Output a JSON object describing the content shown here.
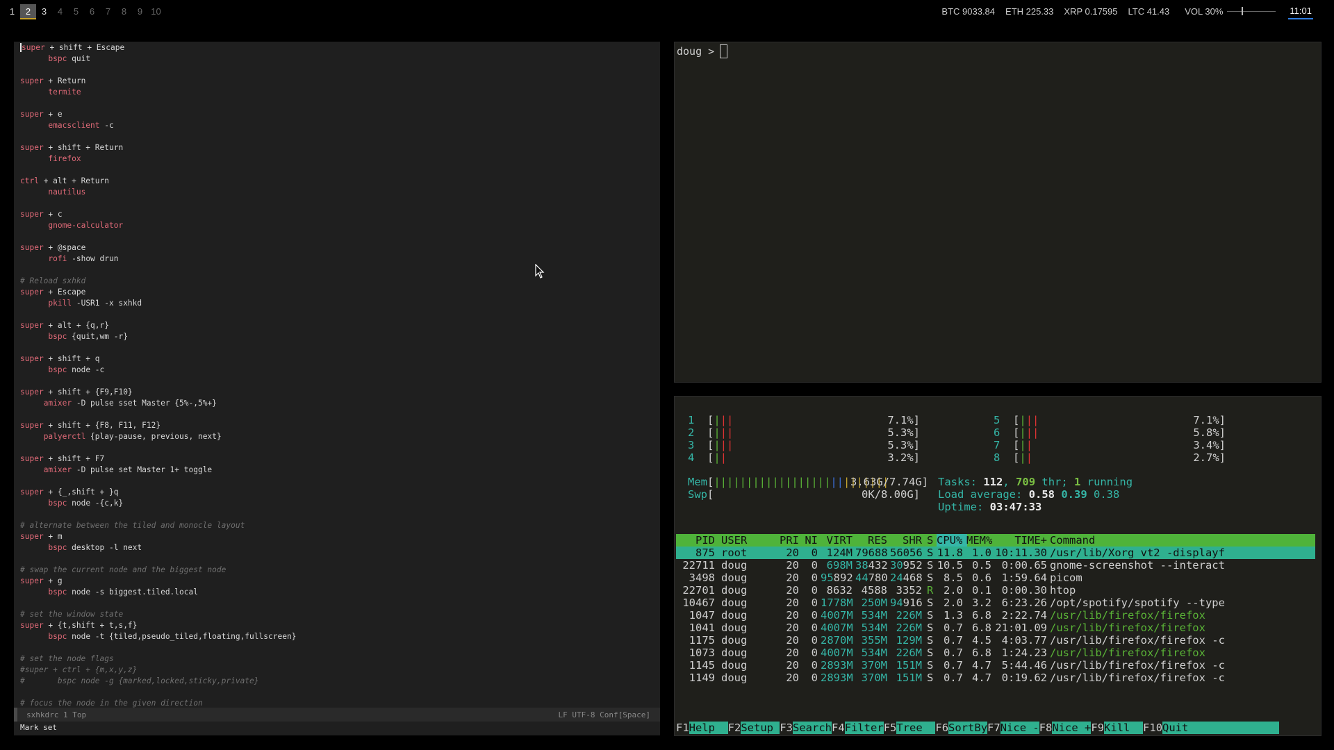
{
  "workspaces": [
    {
      "label": "1",
      "state": "occupied"
    },
    {
      "label": "2",
      "state": "active"
    },
    {
      "label": "3",
      "state": "occupied"
    },
    {
      "label": "4",
      "state": "empty"
    },
    {
      "label": "5",
      "state": "empty"
    },
    {
      "label": "6",
      "state": "empty"
    },
    {
      "label": "7",
      "state": "empty"
    },
    {
      "label": "8",
      "state": "empty"
    },
    {
      "label": "9",
      "state": "empty"
    },
    {
      "label": "10",
      "state": "empty"
    }
  ],
  "status": {
    "btc": "BTC 9033.84",
    "eth": "ETH 225.33",
    "xrp": "XRP 0.17595",
    "ltc": "LTC 41.43",
    "vol": "VOL 30%",
    "vol_level": 0.3,
    "clock": "11:01"
  },
  "editor": {
    "lines": [
      [
        [
          "kw",
          "super"
        ],
        [
          "",
          "+ shift + Escape"
        ]
      ],
      [
        [
          "",
          "      "
        ],
        [
          "kw",
          "bspc"
        ],
        [
          "",
          " quit"
        ]
      ],
      [],
      [
        [
          "kw",
          "super"
        ],
        [
          "",
          " + Return"
        ]
      ],
      [
        [
          "",
          "      "
        ],
        [
          "kw",
          "termite"
        ]
      ],
      [],
      [
        [
          "kw",
          "super"
        ],
        [
          "",
          " + e"
        ]
      ],
      [
        [
          "",
          "      "
        ],
        [
          "kw",
          "emacsclient"
        ],
        [
          "",
          " -c"
        ]
      ],
      [],
      [
        [
          "kw",
          "super"
        ],
        [
          "",
          " + shift + Return"
        ]
      ],
      [
        [
          "",
          "      "
        ],
        [
          "kw",
          "firefox"
        ]
      ],
      [],
      [
        [
          "kw",
          "ctrl"
        ],
        [
          "",
          " + alt + Return"
        ]
      ],
      [
        [
          "",
          "      "
        ],
        [
          "kw",
          "nautilus"
        ]
      ],
      [],
      [
        [
          "kw",
          "super"
        ],
        [
          "",
          " + c"
        ]
      ],
      [
        [
          "",
          "      "
        ],
        [
          "kw",
          "gnome-calculator"
        ]
      ],
      [],
      [
        [
          "kw",
          "super"
        ],
        [
          "",
          " + @space"
        ]
      ],
      [
        [
          "",
          "      "
        ],
        [
          "kw",
          "rofi"
        ],
        [
          "",
          " -show drun"
        ]
      ],
      [],
      [
        [
          "cm",
          "# Reload sxhkd"
        ]
      ],
      [
        [
          "kw",
          "super"
        ],
        [
          "",
          " + Escape"
        ]
      ],
      [
        [
          "",
          "      "
        ],
        [
          "kw",
          "pkill"
        ],
        [
          "",
          " -USR1 -x sxhkd"
        ]
      ],
      [],
      [
        [
          "kw",
          "super"
        ],
        [
          "",
          " + alt + {q,r}"
        ]
      ],
      [
        [
          "",
          "      "
        ],
        [
          "kw",
          "bspc"
        ],
        [
          "",
          " {quit,wm -r}"
        ]
      ],
      [],
      [
        [
          "kw",
          "super"
        ],
        [
          "",
          " + shift + q"
        ]
      ],
      [
        [
          "",
          "      "
        ],
        [
          "kw",
          "bspc"
        ],
        [
          "",
          " node -c"
        ]
      ],
      [],
      [
        [
          "kw",
          "super"
        ],
        [
          "",
          " + shift + {F9,F10}"
        ]
      ],
      [
        [
          "",
          "     "
        ],
        [
          "kw",
          "amixer"
        ],
        [
          "",
          " -D pulse sset Master {5%-,5%+}"
        ]
      ],
      [],
      [
        [
          "kw",
          "super"
        ],
        [
          "",
          " + shift + {F8, F11, F12}"
        ]
      ],
      [
        [
          "",
          "     "
        ],
        [
          "kw",
          "palyerctl"
        ],
        [
          "",
          " {play-pause, previous, next}"
        ]
      ],
      [],
      [
        [
          "kw",
          "super"
        ],
        [
          "",
          " + shift + F7"
        ]
      ],
      [
        [
          "",
          "     "
        ],
        [
          "kw",
          "amixer"
        ],
        [
          "",
          " -D pulse set Master 1+ toggle"
        ]
      ],
      [],
      [
        [
          "kw",
          "super"
        ],
        [
          "",
          " + {_,shift + }q"
        ]
      ],
      [
        [
          "",
          "      "
        ],
        [
          "kw",
          "bspc"
        ],
        [
          "",
          " node -{c,k}"
        ]
      ],
      [],
      [
        [
          "cm",
          "# alternate between the tiled and monocle layout"
        ]
      ],
      [
        [
          "kw",
          "super"
        ],
        [
          "",
          " + m"
        ]
      ],
      [
        [
          "",
          "      "
        ],
        [
          "kw",
          "bspc"
        ],
        [
          "",
          " desktop -l next"
        ]
      ],
      [],
      [
        [
          "cm",
          "# swap the current node and the biggest node"
        ]
      ],
      [
        [
          "kw",
          "super"
        ],
        [
          "",
          " + g"
        ]
      ],
      [
        [
          "",
          "      "
        ],
        [
          "kw",
          "bspc"
        ],
        [
          "",
          " node -s biggest.tiled.local"
        ]
      ],
      [],
      [
        [
          "cm",
          "# set the window state"
        ]
      ],
      [
        [
          "kw",
          "super"
        ],
        [
          "",
          " + {t,shift + t,s,f}"
        ]
      ],
      [
        [
          "",
          "      "
        ],
        [
          "kw",
          "bspc"
        ],
        [
          "",
          " node -t {tiled,pseudo_tiled,floating,fullscreen}"
        ]
      ],
      [],
      [
        [
          "cm",
          "# set the node flags"
        ]
      ],
      [
        [
          "cm",
          "#super + ctrl + {m,x,y,z}"
        ]
      ],
      [
        [
          "cm",
          "#       bspc node -g {marked,locked,sticky,private}"
        ]
      ],
      [],
      [
        [
          "cm",
          "# focus the node in the given direction"
        ]
      ]
    ],
    "modeline_left": "sxhkdrc   1 Top",
    "modeline_right": "LF UTF-8   Conf[Space]",
    "echo": "Mark set"
  },
  "terminal": {
    "prompt": "doug >"
  },
  "htop": {
    "cpus": [
      {
        "id": "1",
        "bars": "|||",
        "pct": "7.1%]"
      },
      {
        "id": "2",
        "bars": "|||",
        "pct": "5.3%]"
      },
      {
        "id": "3",
        "bars": "|||",
        "pct": "5.3%]"
      },
      {
        "id": "4",
        "bars": "||",
        "pct": "3.2%]"
      },
      {
        "id": "5",
        "bars": "|||",
        "pct": "7.1%]"
      },
      {
        "id": "6",
        "bars": "|||",
        "pct": "5.8%]"
      },
      {
        "id": "7",
        "bars": "||",
        "pct": "3.4%]"
      },
      {
        "id": "8",
        "bars": "||",
        "pct": "2.7%]"
      }
    ],
    "mem_label": "Mem",
    "mem_bar_green": "||||||||||||||||||",
    "mem_bar_blue": "||",
    "mem_bar_yellow": "|||||||",
    "mem_value": "3.63G/7.74G]",
    "swp_label": "Swp",
    "swp_value": "0K/8.00G]",
    "tasks_label": "Tasks:",
    "tasks_count": "112",
    "threads": "709",
    "thr_label": "thr;",
    "running_count": "1",
    "running_label": "running",
    "load_label": "Load average:",
    "load1": "0.58",
    "load5": "0.39",
    "load15": "0.38",
    "uptime_label": "Uptime:",
    "uptime": "03:47:33",
    "columns": [
      "PID",
      "USER",
      "PRI",
      "NI",
      "VIRT",
      "RES",
      "SHR",
      "S",
      "CPU%",
      "MEM%",
      "TIME+",
      "Command"
    ],
    "processes": [
      {
        "pid": "875",
        "user": "root",
        "pri": "20",
        "ni": "0",
        "virt": "124M",
        "res": "79688",
        "shr": "56056",
        "s": "S",
        "cpu": "11.8",
        "mem": "1.0",
        "time": "10:11.30",
        "cmd": "/usr/lib/Xorg vt2 -displayf"
      },
      {
        "pid": "22711",
        "user": "doug",
        "pri": "20",
        "ni": "0",
        "virt": "698M",
        "res": "38432",
        "shr": "30952",
        "s": "S",
        "cpu": "10.5",
        "mem": "0.5",
        "time": "0:00.65",
        "cmd": "gnome-screenshot --interact"
      },
      {
        "pid": "3498",
        "user": "doug",
        "pri": "20",
        "ni": "0",
        "virt": "95892",
        "res": "44780",
        "shr": "24468",
        "s": "S",
        "cpu": "8.5",
        "mem": "0.6",
        "time": "1:59.64",
        "cmd": "picom"
      },
      {
        "pid": "22701",
        "user": "doug",
        "pri": "20",
        "ni": "0",
        "virt": "8632",
        "res": "4588",
        "shr": "3352",
        "s": "R",
        "cpu": "2.0",
        "mem": "0.1",
        "time": "0:00.30",
        "cmd": "htop"
      },
      {
        "pid": "10467",
        "user": "doug",
        "pri": "20",
        "ni": "0",
        "virt": "1778M",
        "res": "250M",
        "shr": "94916",
        "s": "S",
        "cpu": "2.0",
        "mem": "3.2",
        "time": "6:23.26",
        "cmd": "/opt/spotify/spotify --type"
      },
      {
        "pid": "1047",
        "user": "doug",
        "pri": "20",
        "ni": "0",
        "virt": "4007M",
        "res": "534M",
        "shr": "226M",
        "s": "S",
        "cpu": "1.3",
        "mem": "6.8",
        "time": "2:22.74",
        "cmd": "/usr/lib/firefox/firefox"
      },
      {
        "pid": "1041",
        "user": "doug",
        "pri": "20",
        "ni": "0",
        "virt": "4007M",
        "res": "534M",
        "shr": "226M",
        "s": "S",
        "cpu": "0.7",
        "mem": "6.8",
        "time": "21:01.09",
        "cmd": "/usr/lib/firefox/firefox"
      },
      {
        "pid": "1175",
        "user": "doug",
        "pri": "20",
        "ni": "0",
        "virt": "2870M",
        "res": "355M",
        "shr": "129M",
        "s": "S",
        "cpu": "0.7",
        "mem": "4.5",
        "time": "4:03.77",
        "cmd": "/usr/lib/firefox/firefox -c"
      },
      {
        "pid": "1073",
        "user": "doug",
        "pri": "20",
        "ni": "0",
        "virt": "4007M",
        "res": "534M",
        "shr": "226M",
        "s": "S",
        "cpu": "0.7",
        "mem": "6.8",
        "time": "1:24.23",
        "cmd": "/usr/lib/firefox/firefox"
      },
      {
        "pid": "1145",
        "user": "doug",
        "pri": "20",
        "ni": "0",
        "virt": "2893M",
        "res": "370M",
        "shr": "151M",
        "s": "S",
        "cpu": "0.7",
        "mem": "4.7",
        "time": "5:44.46",
        "cmd": "/usr/lib/firefox/firefox -c"
      },
      {
        "pid": "1149",
        "user": "doug",
        "pri": "20",
        "ni": "0",
        "virt": "2893M",
        "res": "370M",
        "shr": "151M",
        "s": "S",
        "cpu": "0.7",
        "mem": "4.7",
        "time": "0:19.62",
        "cmd": "/usr/lib/firefox/firefox -c"
      }
    ],
    "fkeys": [
      {
        "key": "F1",
        "label": "Help  "
      },
      {
        "key": "F2",
        "label": "Setup "
      },
      {
        "key": "F3",
        "label": "Search"
      },
      {
        "key": "F4",
        "label": "Filter"
      },
      {
        "key": "F5",
        "label": "Tree  "
      },
      {
        "key": "F6",
        "label": "SortBy"
      },
      {
        "key": "F7",
        "label": "Nice -"
      },
      {
        "key": "F8",
        "label": "Nice +"
      },
      {
        "key": "F9",
        "label": "Kill  "
      },
      {
        "key": "F10",
        "label": "Quit              "
      }
    ]
  }
}
